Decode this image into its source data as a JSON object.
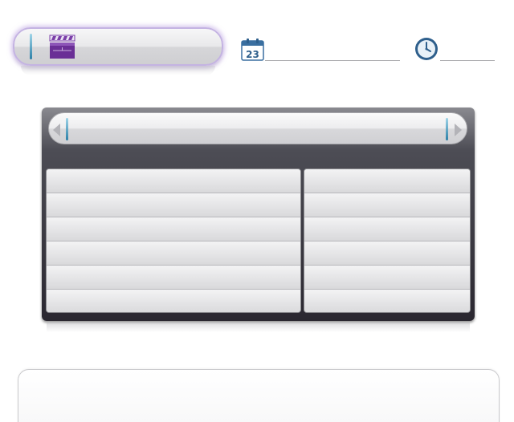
{
  "tabs": [
    {
      "name": "clapperboard",
      "icon": "clapperboard-icon",
      "active": true,
      "accent": "#7b3fa8"
    },
    {
      "name": "calendar",
      "icon": "calendar-icon",
      "day": "23",
      "active": false,
      "accent": "#3a6fa0"
    },
    {
      "name": "clock",
      "icon": "clock-icon",
      "active": false,
      "accent": "#2e5f8c"
    }
  ],
  "search": {
    "left_arrow_icon": "chevron-left-icon",
    "right_arrow_icon": "chevron-right-icon"
  },
  "table": {
    "left_rows": [
      "",
      "",
      "",
      "",
      "",
      ""
    ],
    "right_rows": [
      "",
      "",
      "",
      "",
      "",
      ""
    ]
  },
  "colors": {
    "panel_dark": "#2a2730",
    "active_glow": "#c4b3e2",
    "cursor": "#2c7fa6"
  }
}
